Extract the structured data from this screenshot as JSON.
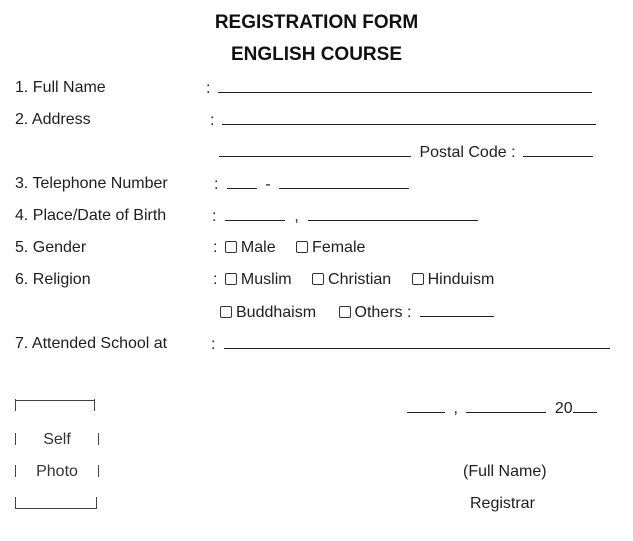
{
  "header": {
    "title": "REGISTRATION FORM",
    "subtitle": "ENGLISH COURSE"
  },
  "fields": {
    "full_name": {
      "label": "1. Full Name",
      "colon": ":"
    },
    "address": {
      "label": "2. Address",
      "colon": ":",
      "postal_code_label": "Postal Code :"
    },
    "telephone": {
      "label": "3. Telephone Number",
      "colon": ":",
      "separator": "-"
    },
    "birth": {
      "label": "4. Place/Date of Birth",
      "colon": ":",
      "separator": ","
    },
    "gender": {
      "label": "5. Gender",
      "colon": ":",
      "options": [
        {
          "label": "Male",
          "checked": false
        },
        {
          "label": "Female",
          "checked": false
        }
      ]
    },
    "religion": {
      "label": "6. Religion",
      "colon": ":",
      "options": [
        {
          "label": "Muslim",
          "checked": false
        },
        {
          "label": "Christian",
          "checked": false
        },
        {
          "label": "Hinduism",
          "checked": false
        },
        {
          "label": "Buddhaism",
          "checked": false
        },
        {
          "label": "Others :",
          "checked": false
        }
      ]
    },
    "school": {
      "label": "7. Attended School at",
      "colon": ":"
    }
  },
  "photo_box": {
    "line1": "Self",
    "line2": "Photo"
  },
  "signature": {
    "date_separator": ",",
    "year_prefix": "20",
    "full_name_hint": "(Full Name)",
    "role": "Registrar"
  }
}
